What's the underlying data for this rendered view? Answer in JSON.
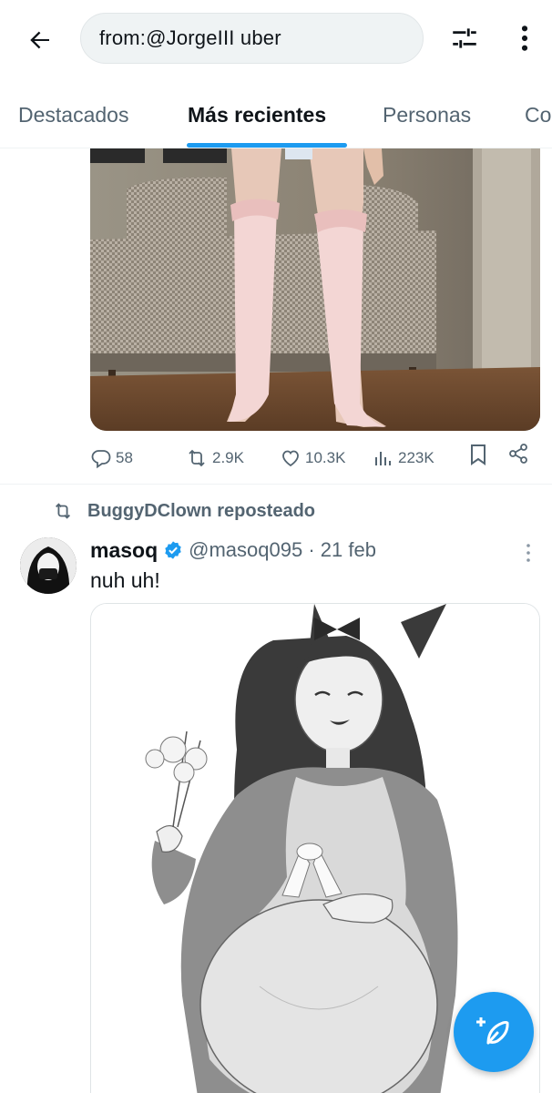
{
  "search": {
    "query": "from:@JorgeIII uber"
  },
  "tabs": [
    {
      "label": "Destacados"
    },
    {
      "label": "Más recientes"
    },
    {
      "label": "Personas"
    },
    {
      "label": "Co"
    }
  ],
  "tweet1": {
    "stats": {
      "replies": "58",
      "reposts": "2.9K",
      "likes": "10.3K",
      "views": "223K"
    }
  },
  "tweet2": {
    "repost_label": "BuggyDClown reposteado",
    "author_name": "masoq",
    "handle_and_date": "@masoq095 · 21 feb",
    "text": "nuh uh!"
  },
  "colors": {
    "accent": "#1d9bf0",
    "text_primary": "#0f1419",
    "text_secondary": "#536471"
  },
  "icons": [
    "back-arrow-icon",
    "filter-sliders-icon",
    "more-vertical-icon",
    "reply-icon",
    "repost-icon",
    "like-icon",
    "views-icon",
    "bookmark-icon",
    "share-icon",
    "verified-badge-icon",
    "compose-icon"
  ]
}
